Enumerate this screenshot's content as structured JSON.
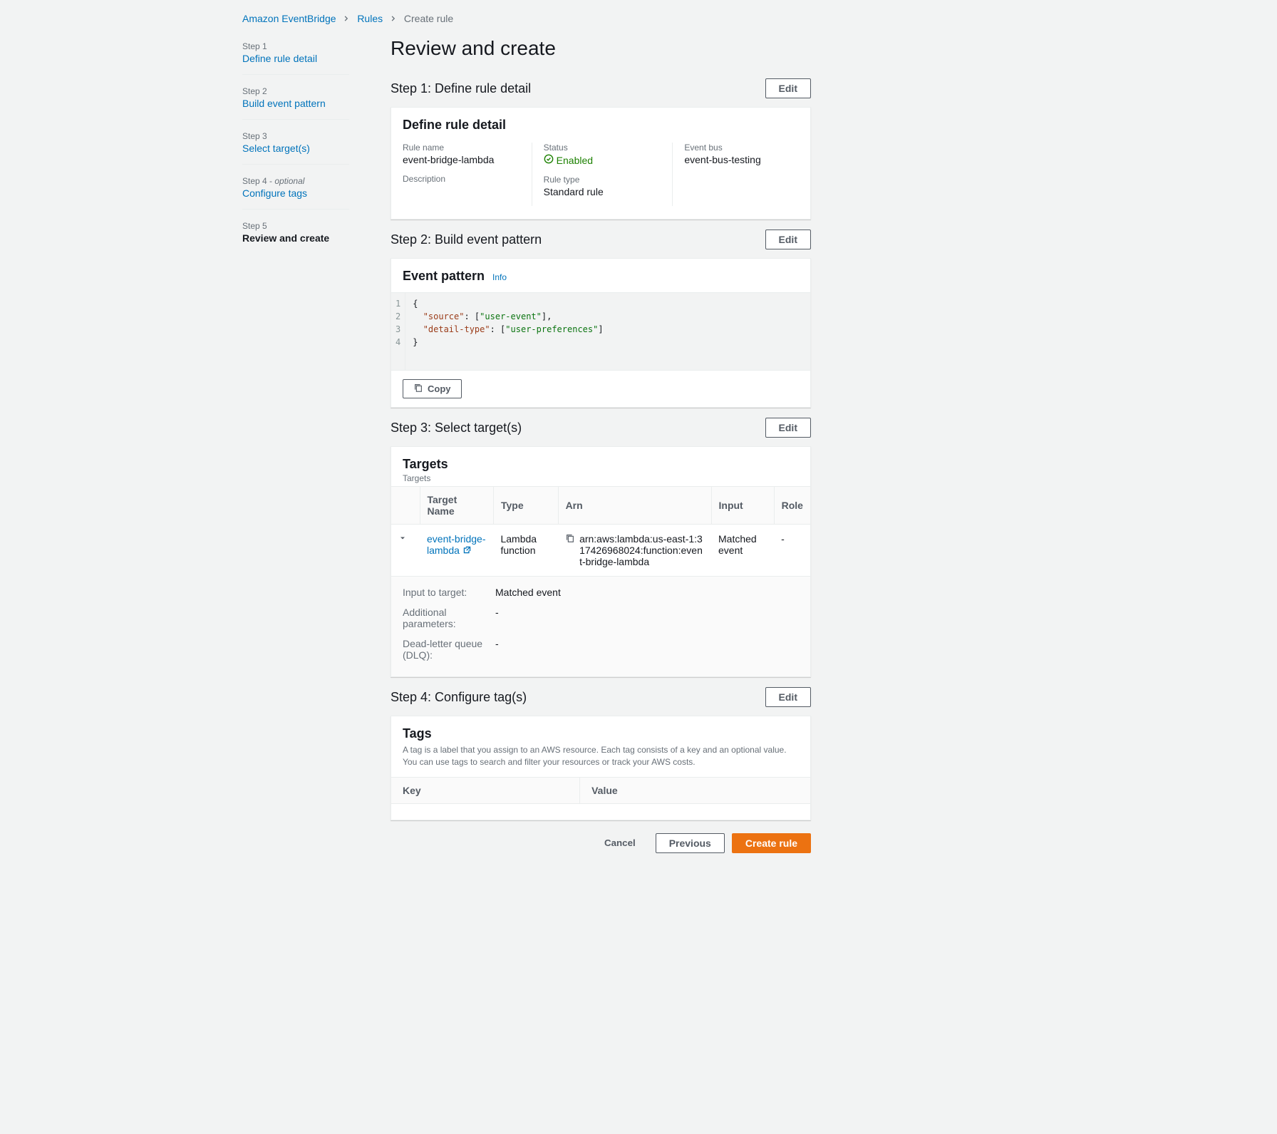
{
  "breadcrumb": {
    "service": "Amazon EventBridge",
    "rules": "Rules",
    "current": "Create rule"
  },
  "sidebar": {
    "steps": [
      {
        "num": "Step 1",
        "label": "Define rule detail",
        "optional": false
      },
      {
        "num": "Step 2",
        "label": "Build event pattern",
        "optional": false
      },
      {
        "num": "Step 3",
        "label": "Select target(s)",
        "optional": false
      },
      {
        "num": "Step 4",
        "label": "Configure tags",
        "optional": true,
        "optional_label": "optional"
      },
      {
        "num": "Step 5",
        "label": "Review and create",
        "optional": false,
        "current": true
      }
    ]
  },
  "page_title": "Review and create",
  "edit_label": "Edit",
  "step1": {
    "heading": "Step 1: Define rule detail",
    "panel_title": "Define rule detail",
    "fields": {
      "rule_name_label": "Rule name",
      "rule_name_value": "event-bridge-lambda",
      "description_label": "Description",
      "description_value": "",
      "status_label": "Status",
      "status_value": "Enabled",
      "rule_type_label": "Rule type",
      "rule_type_value": "Standard rule",
      "event_bus_label": "Event bus",
      "event_bus_value": "event-bus-testing"
    }
  },
  "step2": {
    "heading": "Step 2: Build event pattern",
    "panel_title": "Event pattern",
    "info_label": "Info",
    "code_lines": [
      "1",
      "2",
      "3",
      "4"
    ],
    "code": {
      "l1": "{",
      "l2_pre": "  ",
      "l2_key": "\"source\"",
      "l2_mid": ": [",
      "l2_val": "\"user-event\"",
      "l2_post": "],",
      "l3_pre": "  ",
      "l3_key": "\"detail-type\"",
      "l3_mid": ": [",
      "l3_val": "\"user-preferences\"",
      "l3_post": "]",
      "l4": "}"
    },
    "copy_label": "Copy"
  },
  "step3": {
    "heading": "Step 3: Select target(s)",
    "panel_title": "Targets",
    "panel_subtitle": "Targets",
    "columns": {
      "name": "Target Name",
      "type": "Type",
      "arn": "Arn",
      "input": "Input",
      "role": "Role"
    },
    "row": {
      "name": "event-bridge-lambda",
      "type": "Lambda function",
      "arn": "arn:aws:lambda:us-east-1:317426968024:function:event-bridge-lambda",
      "input": "Matched event",
      "role": "-"
    },
    "details": {
      "input_to_target_label": "Input to target:",
      "input_to_target_value": "Matched event",
      "additional_params_label": "Additional parameters:",
      "additional_params_value": "-",
      "dlq_label": "Dead-letter queue (DLQ):",
      "dlq_value": "-"
    }
  },
  "step4": {
    "heading": "Step 4: Configure tag(s)",
    "panel_title": "Tags",
    "description": "A tag is a label that you assign to an AWS resource. Each tag consists of a key and an optional value. You can use tags to search and filter your resources or track your AWS costs.",
    "columns": {
      "key": "Key",
      "value": "Value"
    }
  },
  "actions": {
    "cancel": "Cancel",
    "previous": "Previous",
    "create": "Create rule"
  }
}
